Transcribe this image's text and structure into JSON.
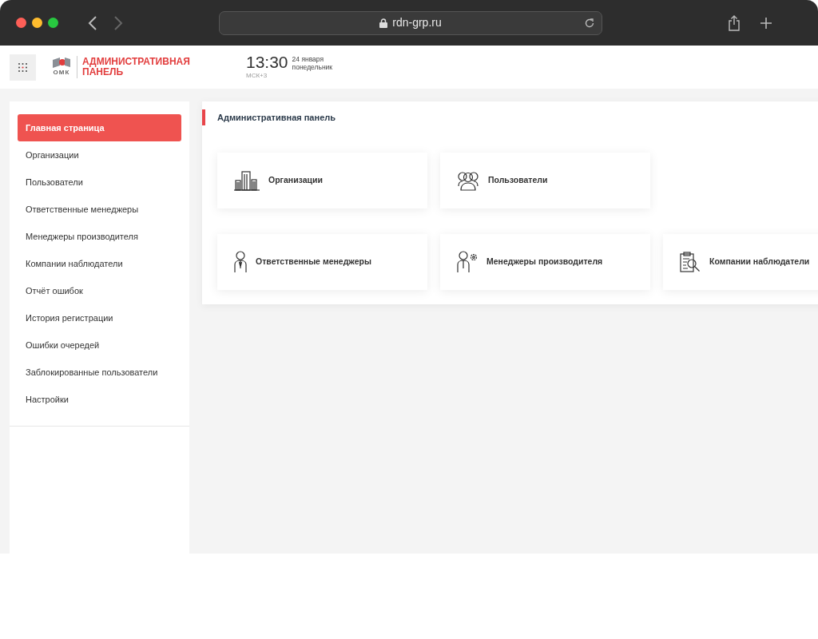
{
  "browser": {
    "url": "rdn-grp.ru"
  },
  "header": {
    "logo_caption": "ОМК",
    "title": "АДМИНИСТРАТИВНАЯ ПАНЕЛЬ",
    "time": "13:30",
    "timezone": "МСК+3",
    "date": "24 января",
    "weekday": "понедельник"
  },
  "sidebar": {
    "items": [
      {
        "label": "Главная страница",
        "selected": true
      },
      {
        "label": "Организации",
        "selected": false
      },
      {
        "label": "Пользователи",
        "selected": false
      },
      {
        "label": "Ответственные менеджеры",
        "selected": false
      },
      {
        "label": "Менеджеры производителя",
        "selected": false
      },
      {
        "label": "Компании наблюдатели",
        "selected": false
      },
      {
        "label": "Отчёт ошибок",
        "selected": false
      },
      {
        "label": "История регистрации",
        "selected": false
      },
      {
        "label": "Ошибки очередей",
        "selected": false
      },
      {
        "label": "Заблокированные пользователи",
        "selected": false
      },
      {
        "label": "Настройки",
        "selected": false
      }
    ]
  },
  "main": {
    "title": "Административная панель",
    "tiles": [
      {
        "kind": "buildings",
        "label": "Организации"
      },
      {
        "kind": "users",
        "label": "Пользователи"
      },
      {
        "kind": "break"
      },
      {
        "kind": "manager",
        "label": "Ответственные менеджеры"
      },
      {
        "kind": "manager-gear",
        "label": "Менеджеры производителя"
      },
      {
        "kind": "clipboard-search",
        "label": "Компании наблюдатели"
      }
    ]
  }
}
